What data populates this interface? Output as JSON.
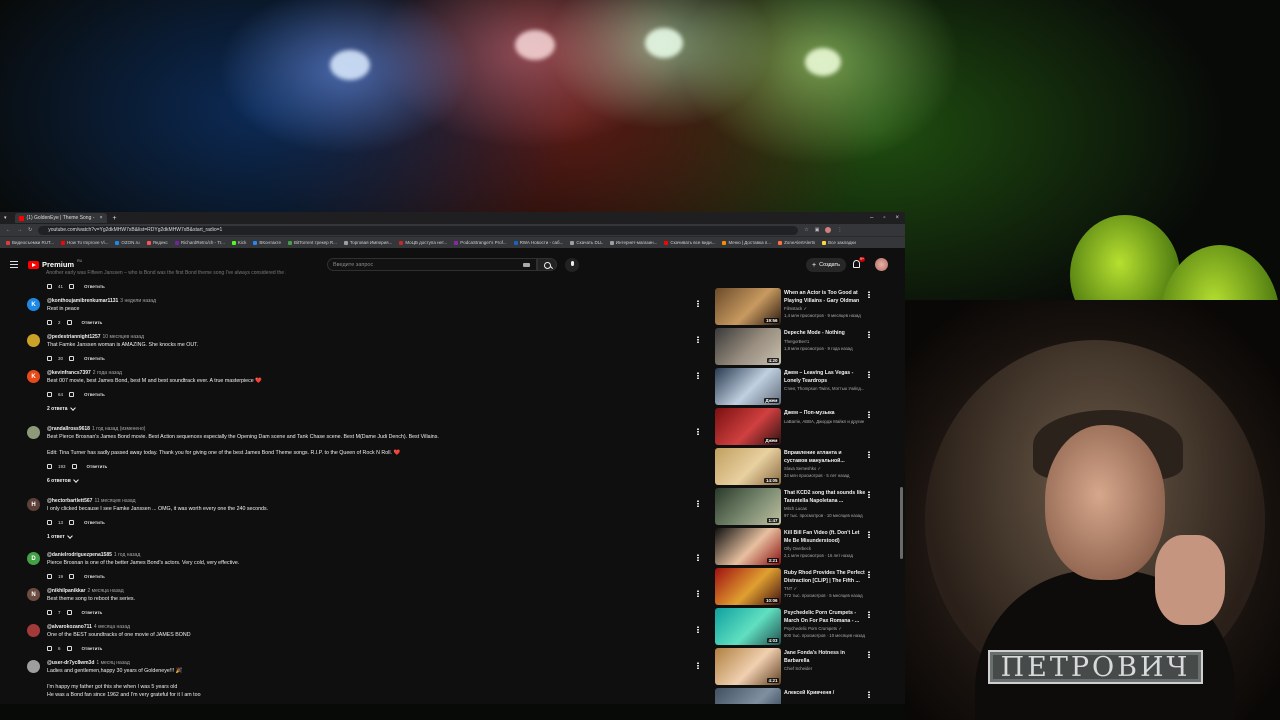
{
  "stream": {
    "name_plate": "ПЕТРОВИЧ"
  },
  "browser": {
    "tab_title": "(1) GoldenEye | Theme Song -",
    "url": "youtube.com/watch?v=Yg2dkMHW7xB&list=RDYg2dkMHW7xB&start_radio=1",
    "bookmarks": [
      {
        "label": "Видеосъемки RUT...",
        "color": "#e53935"
      },
      {
        "label": "How To Improve Vi...",
        "color": "#f00"
      },
      {
        "label": "OZON.ru",
        "color": "#1e88e5"
      },
      {
        "label": "Яндекс",
        "color": "#ff5252"
      },
      {
        "label": "RichardRetro/ch - Tr...",
        "color": "#7b1fa2"
      },
      {
        "label": "Kick",
        "color": "#53fc18"
      },
      {
        "label": "ВКонтакте",
        "color": "#2787f5"
      },
      {
        "label": "BitTorrent трекер R...",
        "color": "#43a047"
      },
      {
        "label": "Торговая Империя...",
        "color": "#9e9e9e"
      },
      {
        "label": "МоЦБ доступа нет...",
        "color": "#c62828"
      },
      {
        "label": "PodcaStranger's Prof...",
        "color": "#8e24aa"
      },
      {
        "label": "RWA Новости - саб...",
        "color": "#1565c0"
      },
      {
        "label": "Скачать DLL",
        "color": "#9e9e9e"
      },
      {
        "label": "Интернет-магазин...",
        "color": "#9e9e9e"
      },
      {
        "label": "Скачивать все види...",
        "color": "#f00"
      },
      {
        "label": "Меню | Доставка п...",
        "color": "#fb8c00"
      },
      {
        "label": "ZoneAlertAlerts",
        "color": "#ff7043"
      },
      {
        "label": "Все закладки",
        "color": "#fdd835"
      }
    ]
  },
  "header": {
    "logo": "Premium",
    "logo_region": "RU",
    "search_placeholder": "Введите запрос",
    "create_label": "Создать",
    "notif_count": "9+"
  },
  "comments": {
    "top_fragment": "Another early was Fifteen Janssen – who is Bond was the first Bond theme song I've always considered the Xenia Onatopp's character a bit more interesting than Soph...",
    "top_likes": "41",
    "reply_label": "Ответить",
    "items": [
      {
        "avatar": "K",
        "avatar_color": "#1e88e5",
        "handle": "@konthoujamibrenkumar1131",
        "time": "3 недели назад",
        "text": [
          "Rest in peace"
        ],
        "likes": "2",
        "replies": ""
      },
      {
        "avatar": "",
        "avatar_color": "#c9a227",
        "handle": "@pedestriannight1257",
        "time": "10 месяцев назад",
        "text": [
          "That Famke Janssen woman is AMAZING. She knocks me OUT."
        ],
        "likes": "30",
        "replies": ""
      },
      {
        "avatar": "K",
        "avatar_color": "#e64a19",
        "handle": "@kevinfrancs7397",
        "time": "2 года назад",
        "text": [
          "Best 007 movie, best James Bond, best M and best soundtrack ever. A true masterpiece ❤️"
        ],
        "likes": "64",
        "replies": "2 ответа"
      },
      {
        "avatar": "",
        "avatar_color": "#8d9a7a",
        "handle": "@randallross9618",
        "time": "1 год назад (изменено)",
        "text": [
          "Best Pierce Brosnan's James Bond movie. Best Action sequences especially the Opening Dam scene and Tank Chase scene. Best M(Dame Judi Dench). Best Villains.",
          "",
          "Edit: Tina Turner has sadly passed away today. Thank you for giving one of the best James Bond Theme songs. R.I.P. to the Queen of Rock N Roll. ❤️"
        ],
        "likes": "193",
        "replies": "6 ответов"
      },
      {
        "avatar": "H",
        "avatar_color": "#5d4037",
        "handle": "@hectorbartlett567",
        "time": "11 месяцев назад",
        "text": [
          "I only clicked because I see Famke Janssen ... OMG, it was worth every one the 240 seconds."
        ],
        "likes": "13",
        "replies": "1 ответ"
      },
      {
        "avatar": "D",
        "avatar_color": "#43a047",
        "handle": "@danielrodriguezpena1585",
        "time": "1 год назад",
        "text": [
          "Pierce Brosnan is one of the better James Bond's actors. Very cold, very effective."
        ],
        "likes": "19",
        "replies": ""
      },
      {
        "avatar": "N",
        "avatar_color": "#6d4c41",
        "handle": "@nikhilpanikkar",
        "time": "2 месяца назад",
        "text": [
          "Best theme song to reboot the series."
        ],
        "likes": "7",
        "replies": ""
      },
      {
        "avatar": "",
        "avatar_color": "#a33a3a",
        "handle": "@alvarokozano711",
        "time": "4 месяца назад",
        "text": [
          "One of the BEST soundtracks of one movie of JAMES BOND"
        ],
        "likes": "6",
        "replies": ""
      },
      {
        "avatar": "",
        "avatar_color": "#9e9e9e",
        "handle": "@user-dr7yc8wm3d",
        "time": "1 месяц назад",
        "text": [
          "Ladies and gentlemen,happy 30 years of Goldeneye!!! 🎉",
          "",
          "I'm happy my father got this she when I was 5 years old",
          "He was a Bond fan since 1962 and I'm very grateful for it I am too"
        ],
        "likes": "",
        "replies": ""
      }
    ]
  },
  "recommendations": [
    {
      "title": "When an Actor is Too Good at Playing Villains - Gary Oldman",
      "channel": "Filmstack ✓",
      "meta": "1,4 млн просмотров · 9 месяцев назад",
      "duration": "19:56",
      "colors": [
        "#6b4a2a",
        "#c89a60",
        "#2a1a10"
      ]
    },
    {
      "title": "Depeche Mode - Nothing",
      "channel": "TheIgorBerr1",
      "meta": "1,8 млн просмотров · 9 года назад",
      "duration": "4:20",
      "colors": [
        "#3a3a3a",
        "#9a8f80",
        "#c8c0b0"
      ]
    },
    {
      "title": "Джем – Leaving Las Vegas - Lonely Teardrops",
      "channel": "Стинг, Thompson Twins, Мэттью Уайлд...",
      "meta": "",
      "duration": "Джем",
      "colors": [
        "#2a3a50",
        "#c0d0e0",
        "#606a7a"
      ]
    },
    {
      "title": "Джем – Поп-музыка",
      "channel": "LaBarrie, ABBA, Джордж Майкл и другие",
      "meta": "",
      "duration": "Джем",
      "colors": [
        "#7a1010",
        "#d04040",
        "#301010"
      ]
    },
    {
      "title": "Вправление атланта и суставов мануальной...",
      "channel": "Slava Semeshko ✓",
      "meta": "34 млн просмотров · 5 лет назад",
      "duration": "14:05",
      "colors": [
        "#c0a060",
        "#e8d0a0",
        "#8a6a40"
      ]
    },
    {
      "title": "That KCD2 song that sounds like Tarantella Napoletana ...",
      "channel": "Mitch Lucas",
      "meta": "97 тыс. просмотров · 10 месяцев назад",
      "duration": "1:47",
      "colors": [
        "#2a3a2a",
        "#7a8a70",
        "#c0c0a0"
      ]
    },
    {
      "title": "Kill Bill Fan Video (ft. Don't Let Me Be Misunderstood)",
      "channel": "Olly Overbeck",
      "meta": "2,1 млн просмотров · 16 лет назад",
      "duration": "3:21",
      "colors": [
        "#101010",
        "#e8c0a0",
        "#8a1010"
      ]
    },
    {
      "title": "Ruby Rhod Provides The Perfect Distraction [CLIP] | The Fifth ...",
      "channel": "TNT ✓",
      "meta": "772 тыс. просмотров · 5 месяцев назад",
      "duration": "10:06",
      "colors": [
        "#a01010",
        "#e0a030",
        "#401010"
      ]
    },
    {
      "title": "Psychedelic Porn Crumpets - March On For Pax Romana - ...",
      "channel": "Psychedelic Porn Crumpets ✓",
      "meta": "800 тыс. просмотров · 10 месяцев назад",
      "duration": "4:03",
      "colors": [
        "#10a0a0",
        "#60e0c0",
        "#205050"
      ]
    },
    {
      "title": "Jane Fonda's Hotness in Barbarella",
      "channel": "Chief Scheider",
      "meta": "",
      "duration": "4:21",
      "colors": [
        "#b08040",
        "#f0d0b0",
        "#604020"
      ]
    },
    {
      "title": "Алексей Кривченя /",
      "channel": "",
      "meta": "",
      "duration": "",
      "colors": [
        "#405060",
        "#8090a0",
        "#203040"
      ]
    }
  ]
}
